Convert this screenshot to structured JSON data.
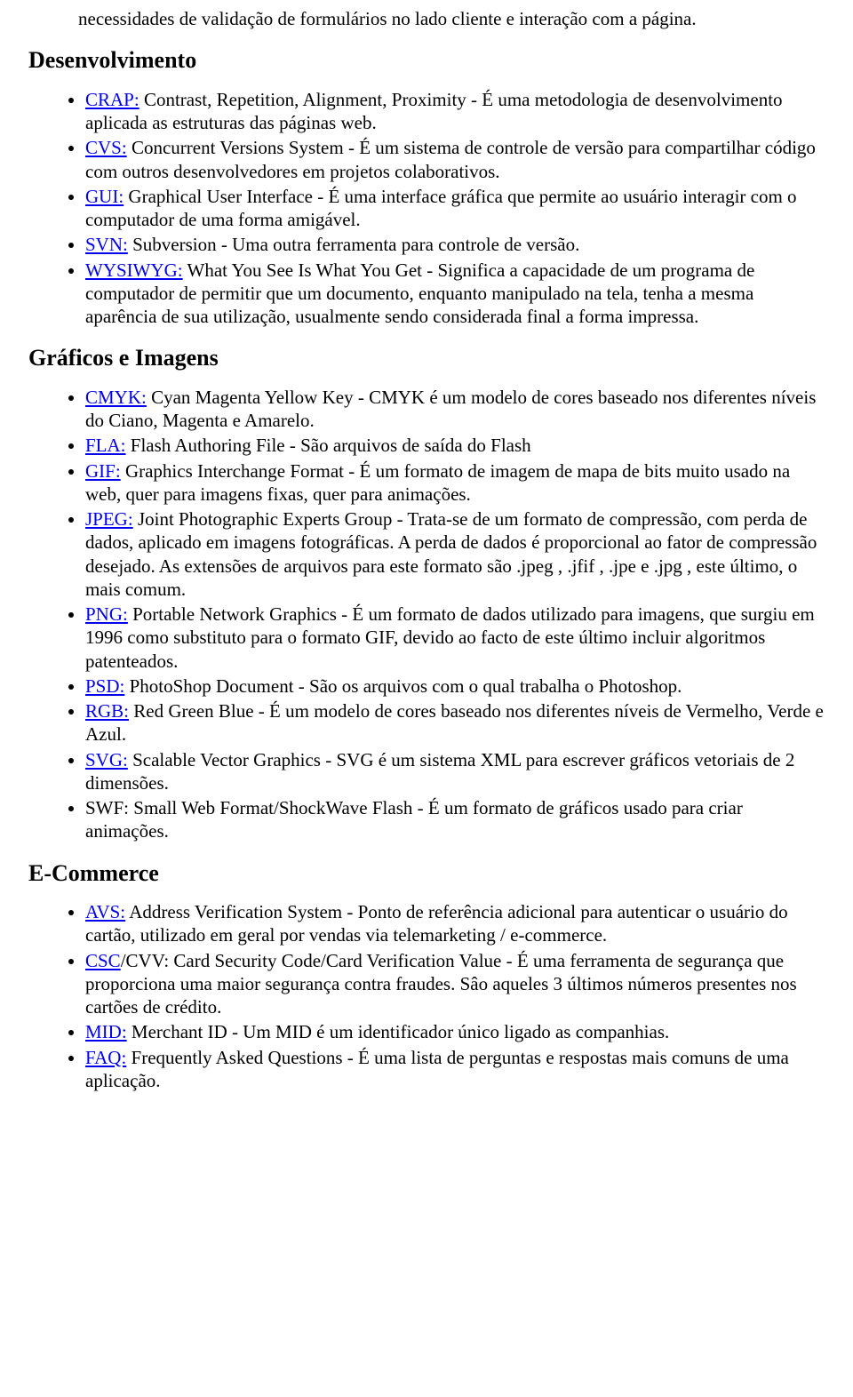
{
  "intro": "necessidades de validação de formulários no lado cliente e interação com a página.",
  "sections": [
    {
      "heading": "Desenvolvimento",
      "items": [
        {
          "link": "CRAP:",
          "text": " Contrast, Repetition, Alignment, Proximity - É uma metodologia de desenvolvimento aplicada as estruturas das páginas web."
        },
        {
          "link": "CVS:",
          "text": " Concurrent Versions System - É um sistema de controle de versão para compartilhar código com outros desenvolvedores em projetos colaborativos."
        },
        {
          "link": "GUI:",
          "text": " Graphical User Interface - É uma interface gráfica que permite ao usuário interagir com o computador de uma forma amigável."
        },
        {
          "link": "SVN:",
          "text": " Subversion - Uma outra ferramenta para controle de versão."
        },
        {
          "link": "WYSIWYG:",
          "text": " What You See Is What You Get - Significa a capacidade de um programa de computador de permitir que um documento, enquanto manipulado na tela, tenha a mesma aparência de sua utilização, usualmente sendo considerada final a forma impressa."
        }
      ]
    },
    {
      "heading": "Gráficos e Imagens",
      "items": [
        {
          "link": "CMYK:",
          "text": " Cyan Magenta Yellow Key - CMYK é um modelo de cores baseado nos diferentes níveis do Ciano, Magenta e Amarelo."
        },
        {
          "link": "FLA:",
          "text": " Flash Authoring File - São arquivos de saída do Flash"
        },
        {
          "link": "GIF:",
          "text": " Graphics Interchange Format - É um formato de imagem de mapa de bits muito usado na web, quer para imagens fixas, quer para animações."
        },
        {
          "link": "JPEG:",
          "text": " Joint Photographic Experts Group - Trata-se de um formato de compressão, com perda de dados, aplicado em imagens fotográficas. A perda de dados é proporcional ao fator de compressão desejado. As extensões de arquivos para este formato são .jpeg , .jfif , .jpe e .jpg , este último, o mais comum."
        },
        {
          "link": "PNG:",
          "text": " Portable Network Graphics - É um formato de dados utilizado para imagens, que surgiu em 1996 como substituto para o formato GIF, devido ao facto de este último incluir algoritmos patenteados."
        },
        {
          "link": "PSD:",
          "text": " PhotoShop Document - São os arquivos com o qual trabalha o Photoshop."
        },
        {
          "link": "RGB:",
          "text": " Red Green Blue - É um modelo de cores baseado nos diferentes níveis de Vermelho, Verde e Azul."
        },
        {
          "link": "SVG:",
          "text": " Scalable Vector Graphics - SVG é um sistema XML para escrever gráficos vetoriais de 2 dimensões."
        },
        {
          "link": "",
          "text": "SWF: Small Web Format/ShockWave Flash - É um formato de gráficos usado para criar animações."
        }
      ]
    },
    {
      "heading": "E-Commerce",
      "items": [
        {
          "link": "AVS:",
          "text": " Address Verification System - Ponto de referência adicional para autenticar o usuário do cartão, utilizado em geral por vendas via telemarketing / e-commerce."
        },
        {
          "link": "CSC",
          "text": "/CVV: Card Security Code/Card Verification Value - É uma ferramenta de segurança que proporciona uma maior segurança contra fraudes. Sâo aqueles 3 últimos números presentes nos cartões de crédito."
        },
        {
          "link": "MID:",
          "text": " Merchant ID - Um MID é um identificador único ligado as companhias."
        },
        {
          "link": "FAQ:",
          "text": " Frequently Asked Questions - É uma lista de perguntas e respostas mais comuns de uma aplicação."
        }
      ]
    }
  ]
}
